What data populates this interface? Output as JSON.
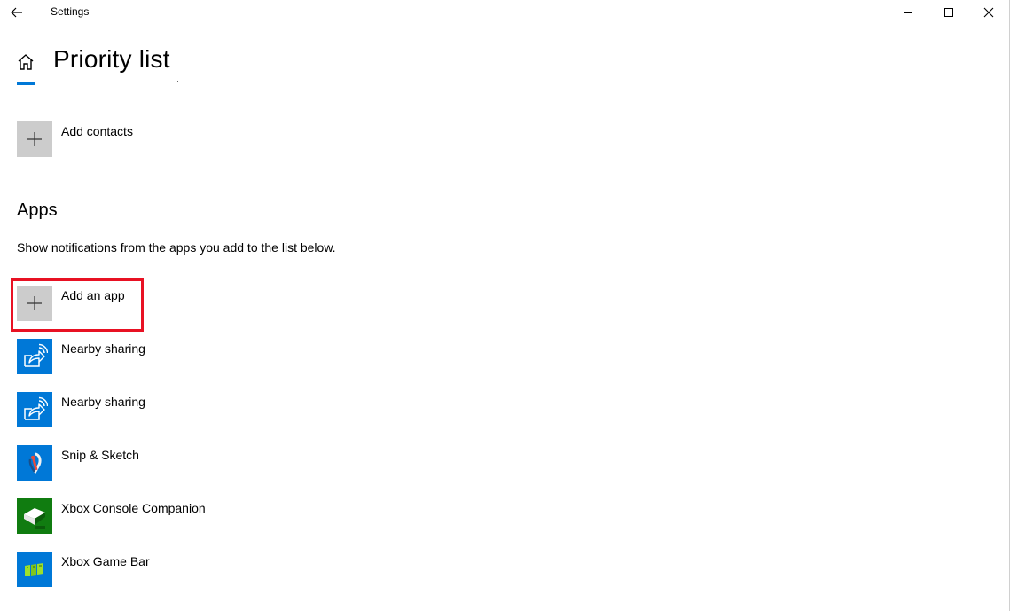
{
  "window": {
    "title": "Settings",
    "controls": {
      "minimize": "minimize-icon",
      "maximize": "maximize-icon",
      "close": "close-icon"
    }
  },
  "header": {
    "title": "Priority list",
    "accent_color": "#0078d7"
  },
  "contacts": {
    "add_label": "Add contacts"
  },
  "apps": {
    "heading": "Apps",
    "description": "Show notifications from the apps you add to the list below.",
    "add_label": "Add an app",
    "items": [
      {
        "label": "Nearby sharing",
        "icon": "nearby-sharing-icon",
        "tile_color": "#0078d7"
      },
      {
        "label": "Nearby sharing",
        "icon": "nearby-sharing-icon",
        "tile_color": "#0078d7"
      },
      {
        "label": "Snip & Sketch",
        "icon": "snip-sketch-icon",
        "tile_color": "#0078d7"
      },
      {
        "label": "Xbox Console Companion",
        "icon": "xbox-console-icon",
        "tile_color": "#107c10"
      },
      {
        "label": "Xbox Game Bar",
        "icon": "xbox-game-bar-icon",
        "tile_color": "#0078d7"
      }
    ]
  },
  "highlight_color": "#e81123"
}
